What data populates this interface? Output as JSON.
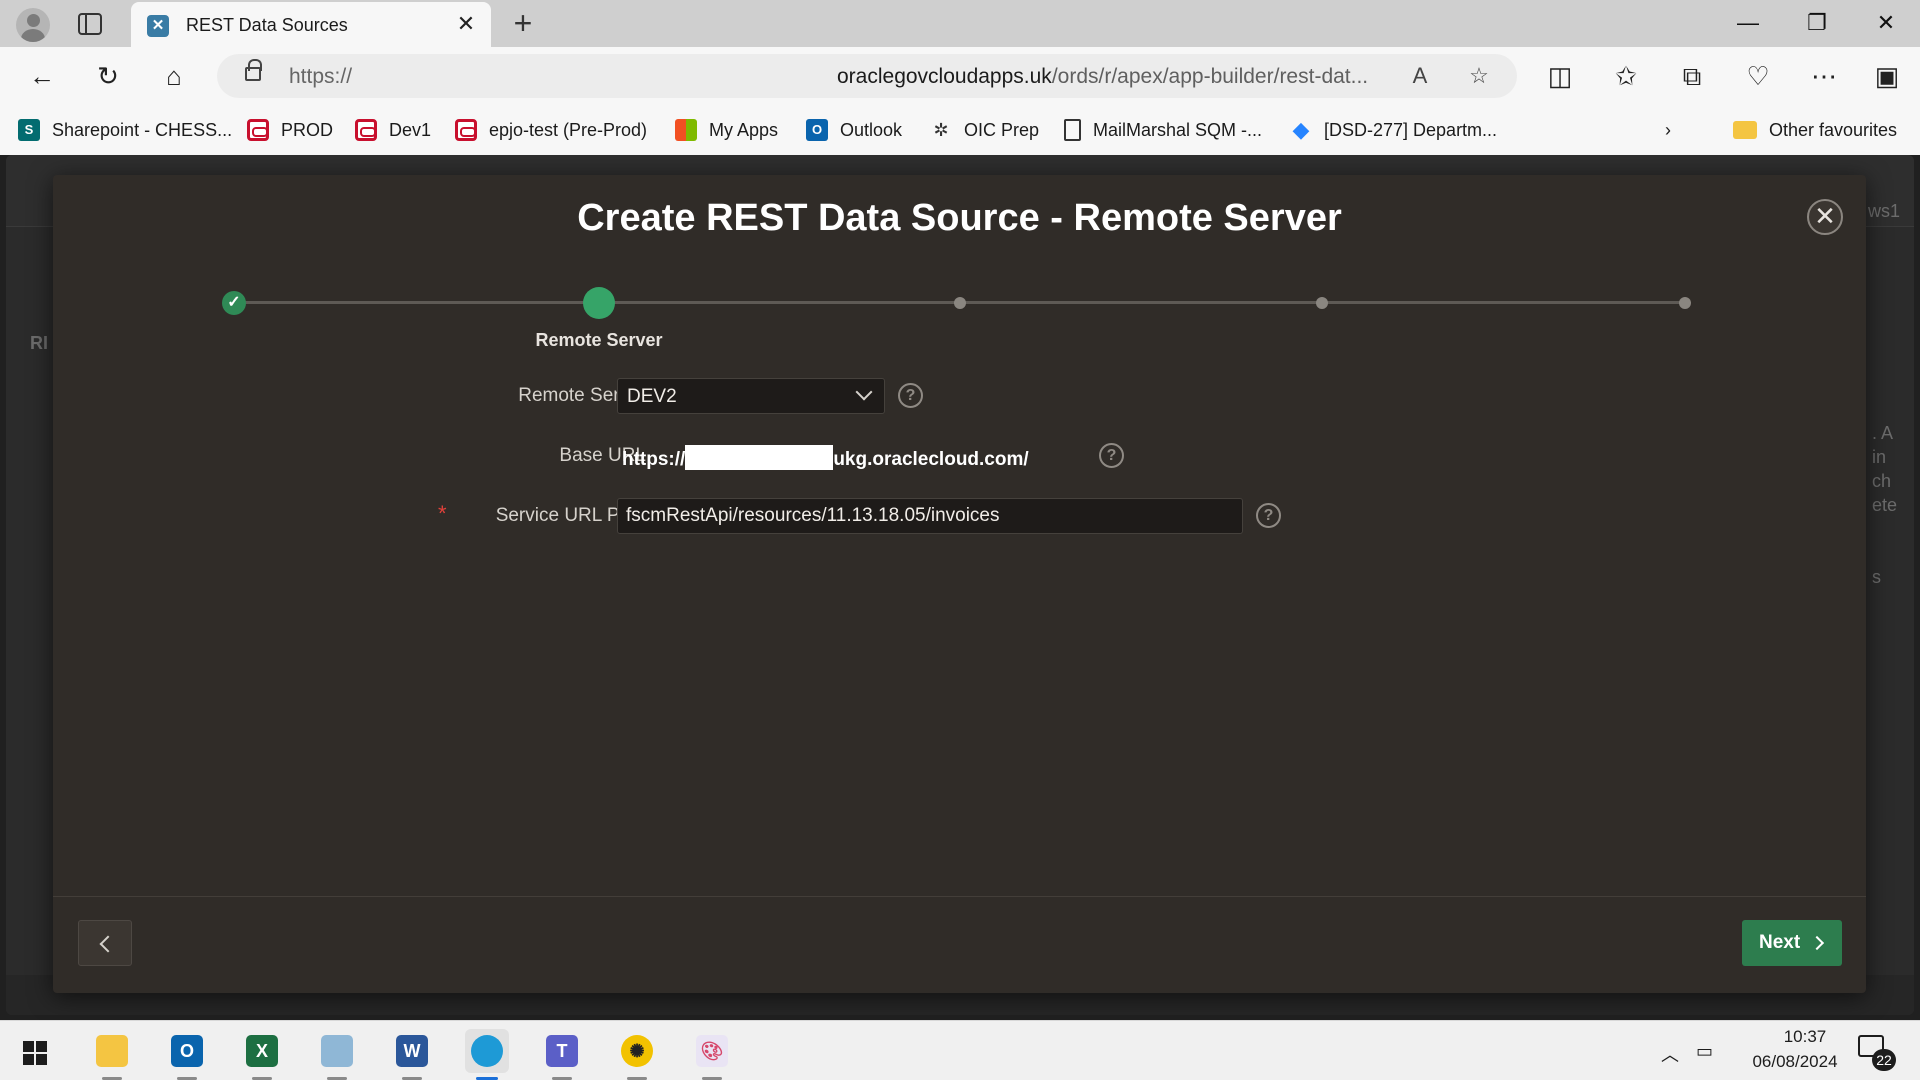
{
  "browser": {
    "tab_title": "REST Data Sources",
    "tab_close": "✕",
    "new_tab": "+",
    "url_proto": "https://",
    "url_host": "oraclegovcloudapps.uk",
    "url_path": "/ords/r/apex/app-builder/rest-dat...",
    "window_controls": {
      "minimize": "—",
      "restore": "❐",
      "close": "✕"
    }
  },
  "favorites": [
    {
      "label": "Sharepoint - CHESS...",
      "icon": "sharepoint-icon"
    },
    {
      "label": "PROD",
      "icon": "oracle-icon"
    },
    {
      "label": "Dev1",
      "icon": "oracle-icon"
    },
    {
      "label": "epjo-test (Pre-Prod)",
      "icon": "oracle-icon"
    },
    {
      "label": "My Apps",
      "icon": "microsoft-icon"
    },
    {
      "label": "Outlook",
      "icon": "outlook-icon"
    },
    {
      "label": "OIC Prep",
      "icon": "oic-icon"
    },
    {
      "label": "MailMarshal SQM -...",
      "icon": "document-icon"
    },
    {
      "label": "[DSD-277] Departm...",
      "icon": "jira-icon"
    },
    {
      "label": "Other favourites",
      "icon": "folder-icon"
    }
  ],
  "background_app": {
    "header_right": "ws1",
    "side_fragments": [
      ". A",
      "in",
      "ch",
      "ete",
      "s"
    ],
    "left_fragment": "RI"
  },
  "modal": {
    "title": "Create REST Data Source - Remote Server",
    "close": "✕",
    "wizard": {
      "current_step_label": "Remote Server",
      "total_steps": 5,
      "current_step": 2
    },
    "fields": {
      "remote_server": {
        "label": "Remote Server",
        "value": "DEV2"
      },
      "base_url": {
        "label": "Base URL",
        "prefix": "https://",
        "suffix": "ukg.oraclecloud.com/"
      },
      "service_url_path": {
        "label": "Service URL Path",
        "required_mark": "*",
        "value": "fscmRestApi/resources/11.13.18.05/invoices"
      }
    },
    "help_glyph": "?",
    "next_label": "Next"
  },
  "taskbar": {
    "time": "10:37",
    "date": "06/08/2024",
    "notification_count": "22",
    "apps": [
      "file-explorer",
      "outlook",
      "excel",
      "notepad",
      "word",
      "edge",
      "teams",
      "chatgpt",
      "paint"
    ]
  },
  "colors": {
    "modal_bg": "#302c28",
    "accent_green": "#2d7d4e",
    "step_current": "#36a468"
  }
}
